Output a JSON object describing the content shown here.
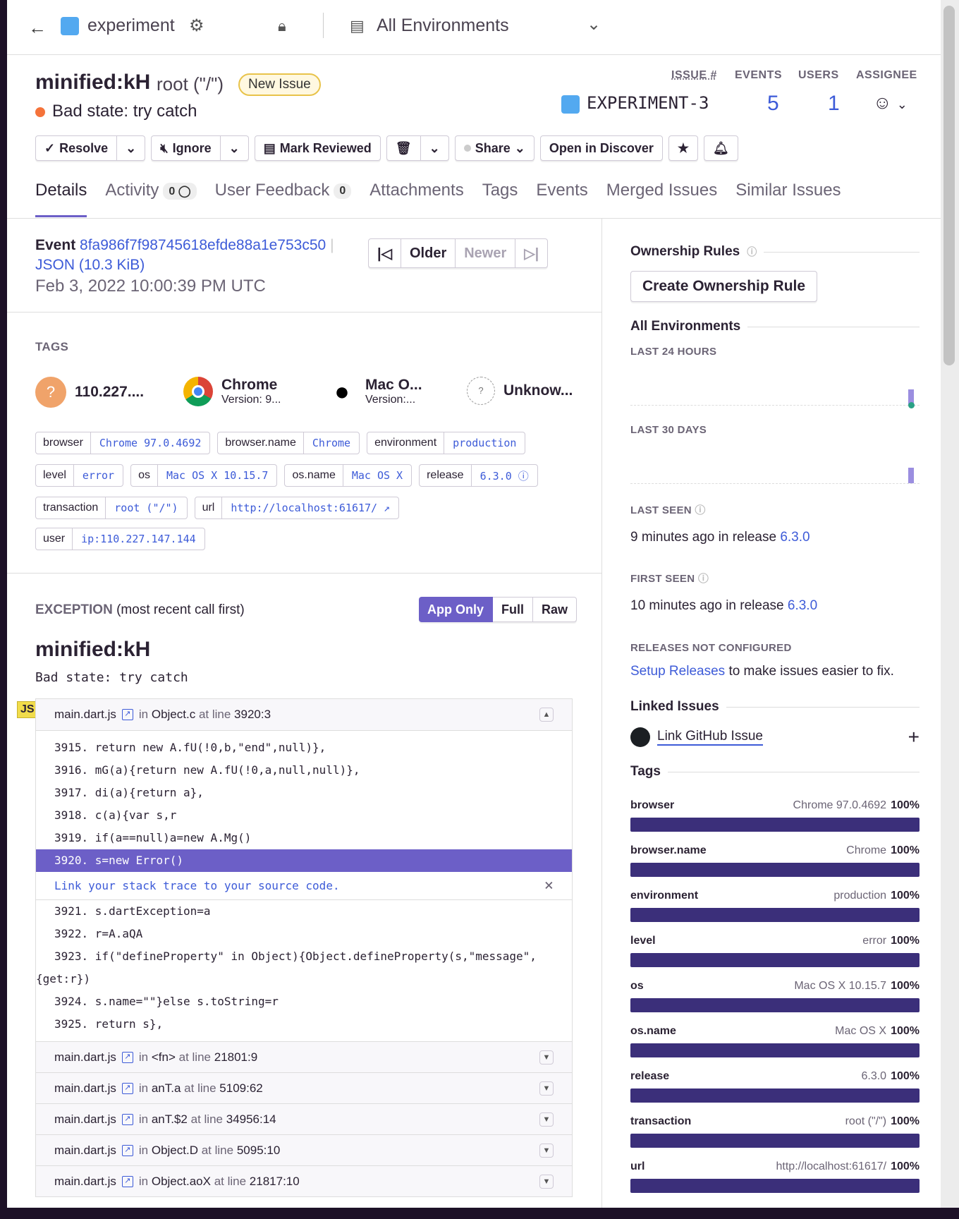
{
  "topbar": {
    "back_icon": "arrow-left-icon",
    "project": "experiment",
    "environment": "All Environments"
  },
  "header": {
    "title": "minified:kH",
    "culprit": "root (\"/\")",
    "badge": "New Issue",
    "message": "Bad state: try catch",
    "stats": {
      "issue_label": "ISSUE #",
      "issue_value": "EXPERIMENT-3",
      "events_label": "EVENTS",
      "events_value": "5",
      "users_label": "USERS",
      "users_value": "1",
      "assignee_label": "ASSIGNEE"
    },
    "actions": {
      "resolve": "Resolve",
      "ignore": "Ignore",
      "mark_reviewed": "Mark Reviewed",
      "share": "Share",
      "discover": "Open in Discover"
    },
    "tabs": [
      {
        "label": "Details"
      },
      {
        "label": "Activity",
        "count": "0"
      },
      {
        "label": "User Feedback",
        "count": "0"
      },
      {
        "label": "Attachments"
      },
      {
        "label": "Tags"
      },
      {
        "label": "Events"
      },
      {
        "label": "Merged Issues"
      },
      {
        "label": "Similar Issues"
      }
    ]
  },
  "event": {
    "label": "Event",
    "id": "8fa986f7f98745618efde88a1e753c50",
    "json": "JSON (10.3 KiB)",
    "date": "Feb 3, 2022 10:00:39 PM UTC",
    "older": "Older",
    "newer": "Newer"
  },
  "tags": {
    "heading": "TAGS",
    "summary": [
      {
        "title": "110.227....",
        "sub": ""
      },
      {
        "title": "Chrome",
        "sub": "Version: 9..."
      },
      {
        "title": "Mac O...",
        "sub": "Version:..."
      },
      {
        "title": "Unknow...",
        "sub": ""
      }
    ],
    "pills": [
      {
        "k": "browser",
        "v": "Chrome 97.0.4692"
      },
      {
        "k": "browser.name",
        "v": "Chrome"
      },
      {
        "k": "environment",
        "v": "production"
      },
      {
        "k": "level",
        "v": "error"
      },
      {
        "k": "os",
        "v": "Mac OS X 10.15.7"
      },
      {
        "k": "os.name",
        "v": "Mac OS X"
      },
      {
        "k": "release",
        "v": "6.3.0"
      },
      {
        "k": "transaction",
        "v": "root (\"/\")"
      },
      {
        "k": "url",
        "v": "http://localhost:61617/"
      },
      {
        "k": "user",
        "v": "ip:110.227.147.144"
      }
    ]
  },
  "exception": {
    "heading": "EXCEPTION",
    "heading_note": "(most recent call first)",
    "views": [
      "App Only",
      "Full",
      "Raw"
    ],
    "type": "minified:kH",
    "value": "Bad state: try catch",
    "badge": "JS",
    "frames": [
      {
        "file": "main.dart.js",
        "in": "in",
        "func": "Object.c",
        "at": "at line",
        "line": "3920:3"
      },
      {
        "file": "main.dart.js",
        "in": "in",
        "func": "<fn>",
        "at": "at line",
        "line": "21801:9"
      },
      {
        "file": "main.dart.js",
        "in": "in",
        "func": "anT.a",
        "at": "at line",
        "line": "5109:62"
      },
      {
        "file": "main.dart.js",
        "in": "in",
        "func": "anT.$2",
        "at": "at line",
        "line": "34956:14"
      },
      {
        "file": "main.dart.js",
        "in": "in",
        "func": "Object.D",
        "at": "at line",
        "line": "5095:10"
      },
      {
        "file": "main.dart.js",
        "in": "in",
        "func": "Object.aoX",
        "at": "at line",
        "line": "21817:10"
      }
    ],
    "code_before": [
      "3915. return new A.fU(!0,b,\"end\",null)},",
      "3916. mG(a){return new A.fU(!0,a,null,null)},",
      "3917. di(a){return a},",
      "3918. c(a){var s,r",
      "3919. if(a==null)a=new A.Mg()"
    ],
    "code_highlight": "3920. s=new Error()",
    "source_hint": "Link your stack trace to your source code.",
    "code_after": [
      "3921. s.dartException=a",
      "3922. r=A.aQA",
      "3923. if(\"defineProperty\" in Object){Object.defineProperty(s,\"message\",",
      "{get:r})",
      "3924. s.name=\"\"}else s.toString=r",
      "3925. return s},"
    ]
  },
  "sidebar": {
    "ownership_title": "Ownership Rules",
    "create_rule": "Create Ownership Rule",
    "all_envs": "All Environments",
    "last24": "LAST 24 HOURS",
    "last30": "LAST 30 DAYS",
    "last_seen_label": "LAST SEEN",
    "last_seen_time": "9 minutes ago",
    "last_seen_in": "in release",
    "last_seen_release": "6.3.0",
    "first_seen_label": "FIRST SEEN",
    "first_seen_time": "10 minutes ago",
    "first_seen_in": "in release",
    "first_seen_release": "6.3.0",
    "releases_label": "RELEASES NOT CONFIGURED",
    "setup_link": "Setup Releases",
    "setup_rest": "to make issues easier to fix.",
    "linked_title": "Linked Issues",
    "github_link": "Link GitHub Issue",
    "tags_title": "Tags",
    "tag_dist": [
      {
        "key": "browser",
        "value": "Chrome 97.0.4692",
        "pct": "100%"
      },
      {
        "key": "browser.name",
        "value": "Chrome",
        "pct": "100%"
      },
      {
        "key": "environment",
        "value": "production",
        "pct": "100%"
      },
      {
        "key": "level",
        "value": "error",
        "pct": "100%"
      },
      {
        "key": "os",
        "value": "Mac OS X 10.15.7",
        "pct": "100%"
      },
      {
        "key": "os.name",
        "value": "Mac OS X",
        "pct": "100%"
      },
      {
        "key": "release",
        "value": "6.3.0",
        "pct": "100%"
      },
      {
        "key": "transaction",
        "value": "root (\"/\")",
        "pct": "100%"
      },
      {
        "key": "url",
        "value": "http://localhost:61617/",
        "pct": "100%"
      }
    ]
  },
  "colors": {
    "accent": "#6c5fc7",
    "link": "#3d5bd8",
    "bar": "#3b2f7a",
    "error_dot": "#f5733a"
  }
}
